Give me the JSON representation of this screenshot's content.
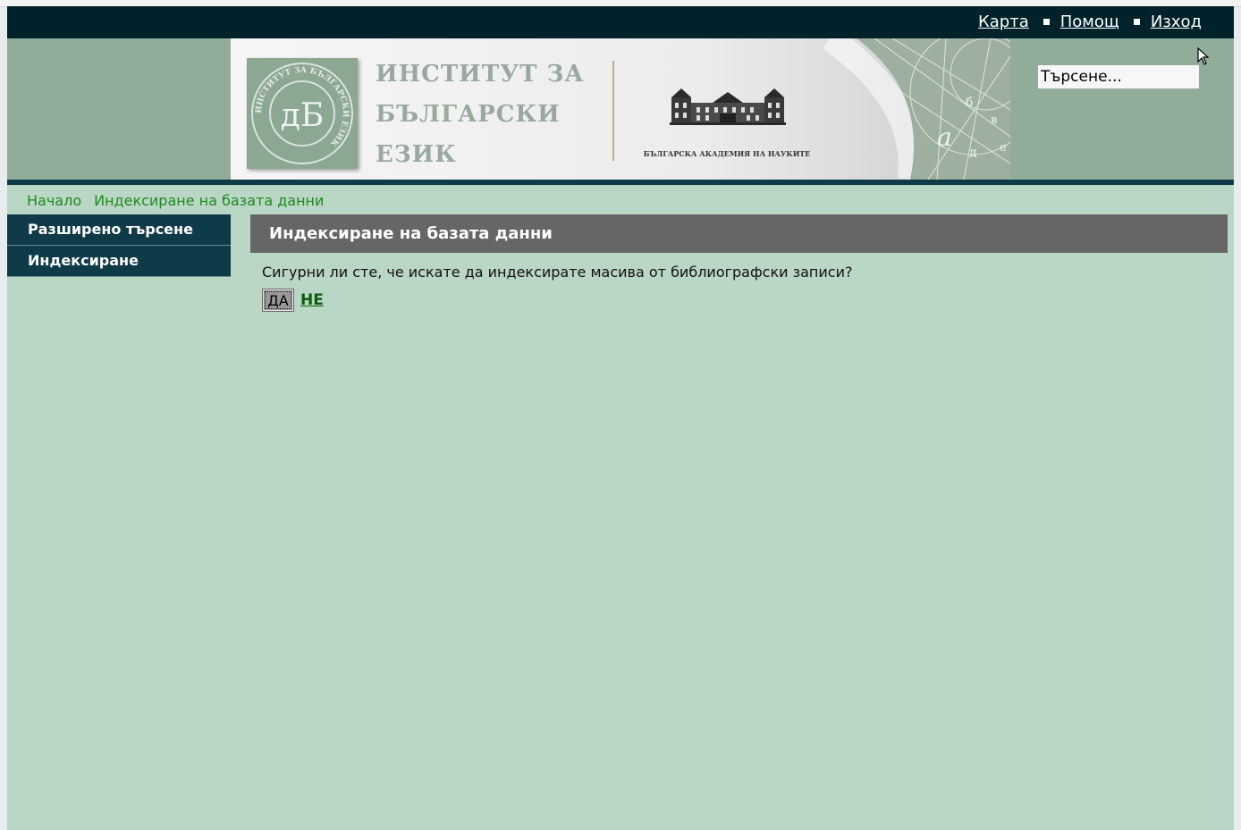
{
  "topbar": {
    "links": [
      "Карта",
      "Помощ",
      "Изход"
    ]
  },
  "header": {
    "institute_name": [
      "ИНСТИТУТ ЗА",
      "БЪЛГАРСКИ",
      "ЕЗИК"
    ],
    "logo_monogram": "дБ",
    "logo_ring_text": "ИНСТИТУТ ЗА БЪЛГАРСКИ ЕЗИК",
    "academy_label": "БЪЛГАРСКА АКАДЕМИЯ НА НАУКИТЕ",
    "banner_letters": [
      "а",
      "б",
      "в",
      "д",
      "е"
    ]
  },
  "search": {
    "placeholder": "Търсене..."
  },
  "breadcrumb": {
    "items": [
      "Начало",
      "Индексиране на базата данни"
    ]
  },
  "sidebar": {
    "items": [
      {
        "label": "Разширено търсене"
      },
      {
        "label": "Индексиране"
      }
    ]
  },
  "main": {
    "title": "Индексиране на базата данни",
    "question": "Сигурни ли сте, че искате да индексирате масива от библиографски записи?",
    "yes_label": "ДА",
    "no_label": "НЕ"
  },
  "colors": {
    "topbar_bg": "#00222a",
    "header_bg": "#91ad99",
    "page_bg": "#bad6c5",
    "sidebar_bg": "#0f3a48",
    "panel_head_bg": "#666666",
    "breadcrumb_text": "#1e8a1e",
    "no_link": "#0a5c0a"
  },
  "icons": [
    "mouse-pointer-icon",
    "bullet-square-icon"
  ]
}
